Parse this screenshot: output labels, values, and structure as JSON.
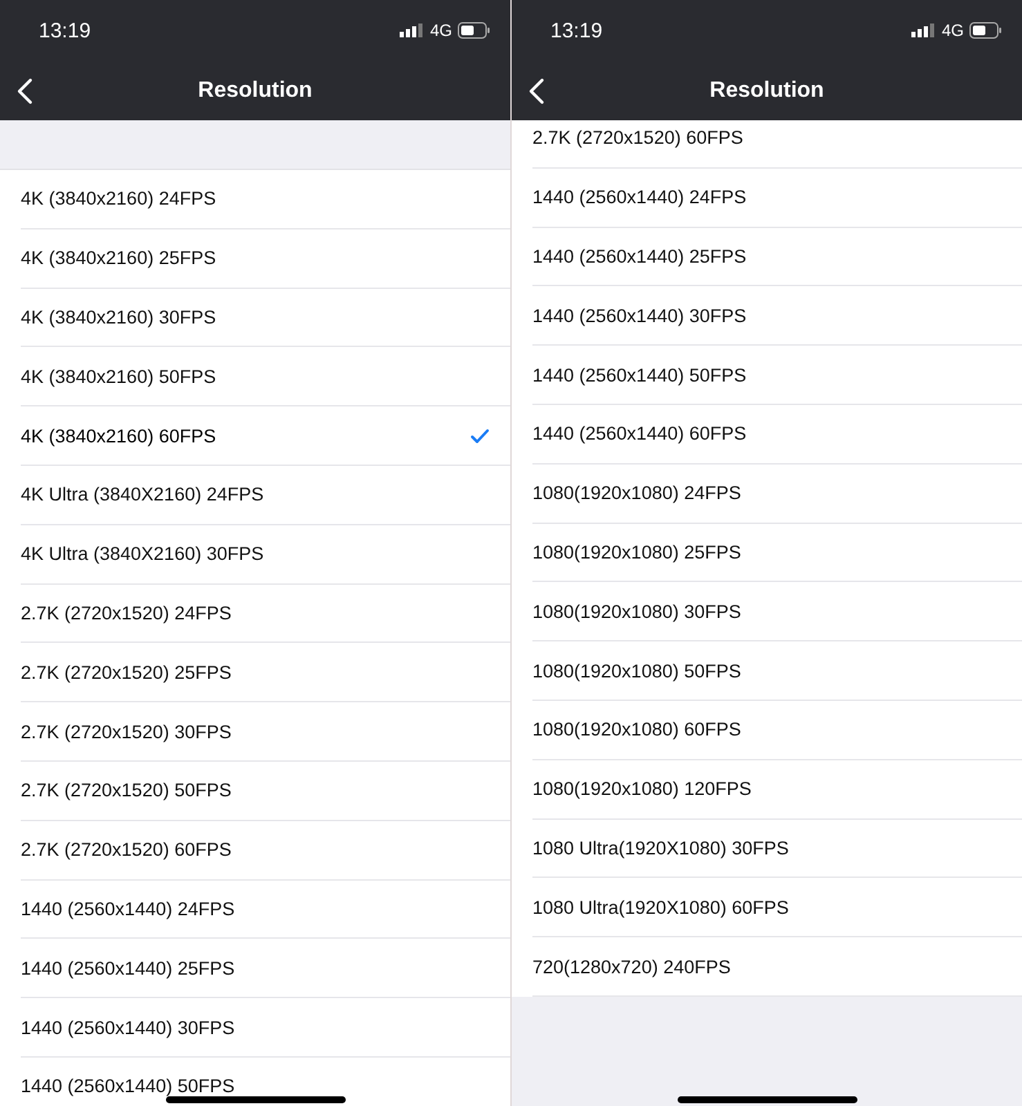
{
  "screens": [
    {
      "status_bar": {
        "time": "13:19",
        "network": "4G"
      },
      "nav_bar": {
        "title": "Resolution"
      },
      "scrolled": false,
      "items": [
        {
          "label": "4K (3840x2160) 24FPS",
          "selected": false
        },
        {
          "label": "4K (3840x2160) 25FPS",
          "selected": false
        },
        {
          "label": "4K (3840x2160) 30FPS",
          "selected": false
        },
        {
          "label": "4K (3840x2160) 50FPS",
          "selected": false
        },
        {
          "label": "4K (3840x2160) 60FPS",
          "selected": true
        },
        {
          "label": "4K Ultra (3840X2160) 24FPS",
          "selected": false
        },
        {
          "label": "4K Ultra (3840X2160) 30FPS",
          "selected": false
        },
        {
          "label": "2.7K (2720x1520) 24FPS",
          "selected": false
        },
        {
          "label": "2.7K (2720x1520) 25FPS",
          "selected": false
        },
        {
          "label": "2.7K (2720x1520) 30FPS",
          "selected": false
        },
        {
          "label": "2.7K (2720x1520) 50FPS",
          "selected": false
        },
        {
          "label": "2.7K (2720x1520) 60FPS",
          "selected": false
        },
        {
          "label": "1440 (2560x1440) 24FPS",
          "selected": false
        },
        {
          "label": "1440 (2560x1440) 25FPS",
          "selected": false
        },
        {
          "label": "1440 (2560x1440) 30FPS",
          "selected": false
        },
        {
          "label": "1440 (2560x1440) 50FPS",
          "selected": false
        }
      ]
    },
    {
      "status_bar": {
        "time": "13:19",
        "network": "4G"
      },
      "nav_bar": {
        "title": "Resolution"
      },
      "scrolled": true,
      "items": [
        {
          "label": "2.7K (2720x1520) 60FPS",
          "selected": false
        },
        {
          "label": "1440 (2560x1440) 24FPS",
          "selected": false
        },
        {
          "label": "1440 (2560x1440) 25FPS",
          "selected": false
        },
        {
          "label": "1440 (2560x1440) 30FPS",
          "selected": false
        },
        {
          "label": "1440 (2560x1440) 50FPS",
          "selected": false
        },
        {
          "label": "1440 (2560x1440) 60FPS",
          "selected": false
        },
        {
          "label": "1080(1920x1080) 24FPS",
          "selected": false
        },
        {
          "label": "1080(1920x1080) 25FPS",
          "selected": false
        },
        {
          "label": "1080(1920x1080) 30FPS",
          "selected": false
        },
        {
          "label": "1080(1920x1080) 50FPS",
          "selected": false
        },
        {
          "label": "1080(1920x1080) 60FPS",
          "selected": false
        },
        {
          "label": "1080(1920x1080) 120FPS",
          "selected": false
        },
        {
          "label": "1080 Ultra(1920X1080) 30FPS",
          "selected": false
        },
        {
          "label": "1080 Ultra(1920X1080) 60FPS",
          "selected": false
        },
        {
          "label": "720(1280x720) 240FPS",
          "selected": false
        }
      ]
    }
  ]
}
